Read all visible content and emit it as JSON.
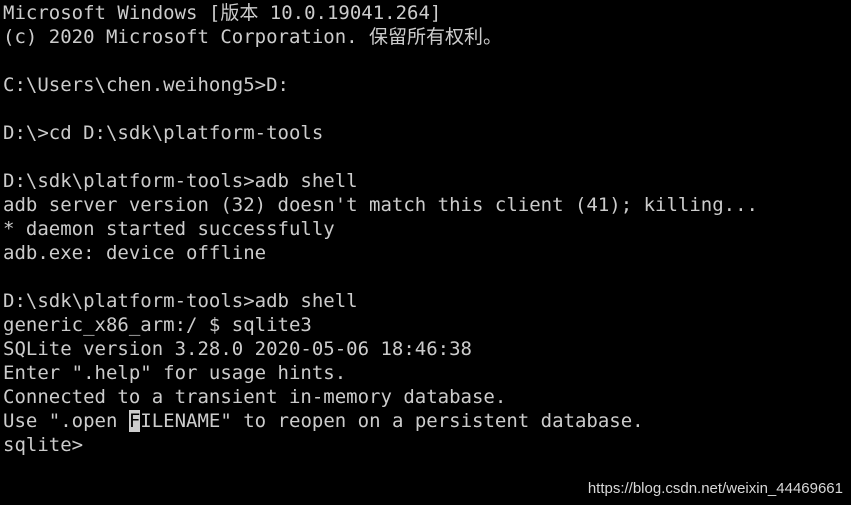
{
  "console": {
    "lines": [
      "Microsoft Windows [版本 10.0.19041.264]",
      "(c) 2020 Microsoft Corporation. 保留所有权利。",
      "",
      "C:\\Users\\chen.weihong5>D:",
      "",
      "D:\\>cd D:\\sdk\\platform-tools",
      "",
      "D:\\sdk\\platform-tools>adb shell",
      "adb server version (32) doesn't match this client (41); killing...",
      "* daemon started successfully",
      "adb.exe: device offline",
      "",
      "D:\\sdk\\platform-tools>adb shell",
      "generic_x86_arm:/ $ sqlite3",
      "SQLite version 3.28.0 2020-05-06 18:46:38",
      "Enter \".help\" for usage hints.",
      "Connected to a transient in-memory database."
    ],
    "line18_before_cursor": "Use \".open ",
    "line18_cursor_char": "F",
    "line18_after_cursor": "ILENAME\" to reopen on a persistent database.",
    "prompt": "sqlite>"
  },
  "watermark": "https://blog.csdn.net/weixin_44469661"
}
